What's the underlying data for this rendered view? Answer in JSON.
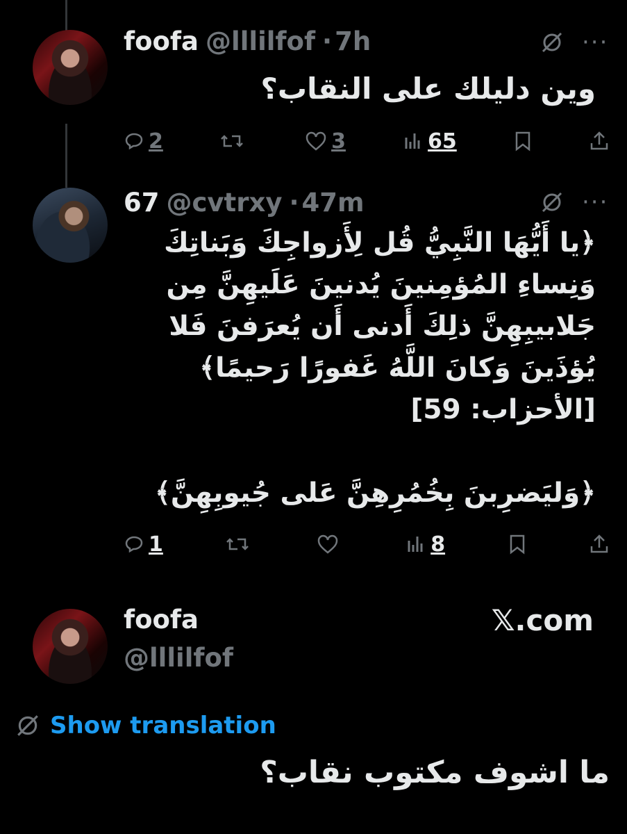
{
  "tweet1": {
    "name": "foofa",
    "handle": "@lllilfof",
    "separator": "·",
    "time": "7h",
    "text": "وين دليلك على النقاب؟",
    "replies": "2",
    "retweets": "",
    "likes": "3",
    "views": "65"
  },
  "tweet2": {
    "name": "67",
    "handle": "@cvtrxy",
    "separator": "·",
    "time": "47m",
    "text_lines": [
      "﴿يا أَيُّهَا النَّبِيُّ قُل لِأَزواجِكَ وَبَناتِكَ",
      "وَنِساءِ المُؤمِنينَ يُدنينَ عَلَيهِنَّ مِن",
      "جَلابيبِهِنَّ ذلِكَ أَدنى أَن يُعرَفنَ فَلا",
      "يُؤذَينَ وَكانَ اللَّهُ غَفورًا رَحيمًا﴾",
      "[الأحزاب: 59]",
      "﴿وَليَضرِبنَ بِخُمُرِهِنَّ عَلى جُيوبِهِنَّ﴾"
    ],
    "replies": "1",
    "retweets": "",
    "likes": "",
    "views": "8"
  },
  "tweet3": {
    "name": "foofa",
    "handle": "@lllilfof",
    "brand": "𝕏.com",
    "show_translation": "Show translation",
    "text": "ما اشوف مكتوب نقاب؟"
  },
  "colors": {
    "background": "#000000",
    "text": "#e7e9ea",
    "muted": "#71767b",
    "link": "#1d9bf0",
    "thread_line": "#333639"
  }
}
